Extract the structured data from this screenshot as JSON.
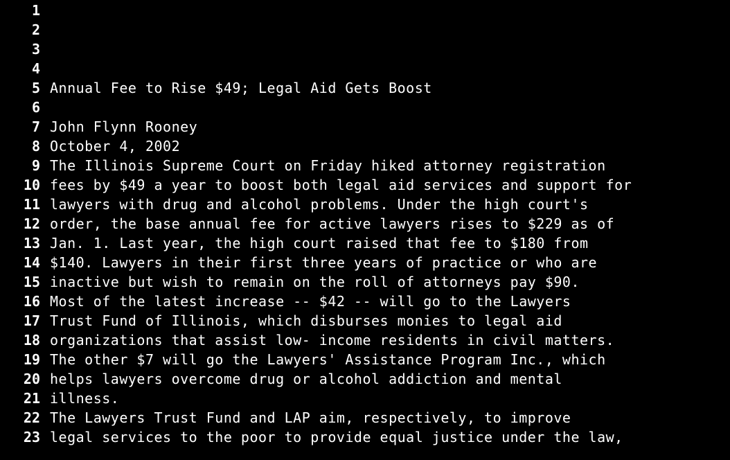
{
  "colors": {
    "background": "#000000",
    "text": "#ffffff"
  },
  "lines": [
    {
      "num": "1",
      "text": ""
    },
    {
      "num": "2",
      "text": ""
    },
    {
      "num": "3",
      "text": ""
    },
    {
      "num": "4",
      "text": ""
    },
    {
      "num": "5",
      "text": "Annual Fee to Rise $49; Legal Aid Gets Boost"
    },
    {
      "num": "6",
      "text": ""
    },
    {
      "num": "7",
      "text": "John Flynn Rooney"
    },
    {
      "num": "8",
      "text": "October 4, 2002"
    },
    {
      "num": "9",
      "text": "The Illinois Supreme Court on Friday hiked attorney registration"
    },
    {
      "num": "10",
      "text": "fees by $49 a year to boost both legal aid services and support for"
    },
    {
      "num": "11",
      "text": "lawyers with drug and alcohol problems. Under the high court's"
    },
    {
      "num": "12",
      "text": "order, the base annual fee for active lawyers rises to $229 as of"
    },
    {
      "num": "13",
      "text": "Jan. 1. Last year, the high court raised that fee to $180 from"
    },
    {
      "num": "14",
      "text": "$140. Lawyers in their first three years of practice or who are"
    },
    {
      "num": "15",
      "text": "inactive but wish to remain on the roll of attorneys pay $90."
    },
    {
      "num": "16",
      "text": "Most of the latest increase -- $42 -- will go to the Lawyers"
    },
    {
      "num": "17",
      "text": "Trust Fund of Illinois, which disburses monies to legal aid"
    },
    {
      "num": "18",
      "text": "organizations that assist low- income residents in civil matters."
    },
    {
      "num": "19",
      "text": "The other $7 will go the Lawyers' Assistance Program Inc., which"
    },
    {
      "num": "20",
      "text": "helps lawyers overcome drug or alcohol addiction and mental"
    },
    {
      "num": "21",
      "text": "illness."
    },
    {
      "num": "22",
      "text": "The Lawyers Trust Fund and LAP aim, respectively, to improve"
    },
    {
      "num": "23",
      "text": "legal services to the poor to provide equal justice under the law,"
    }
  ]
}
